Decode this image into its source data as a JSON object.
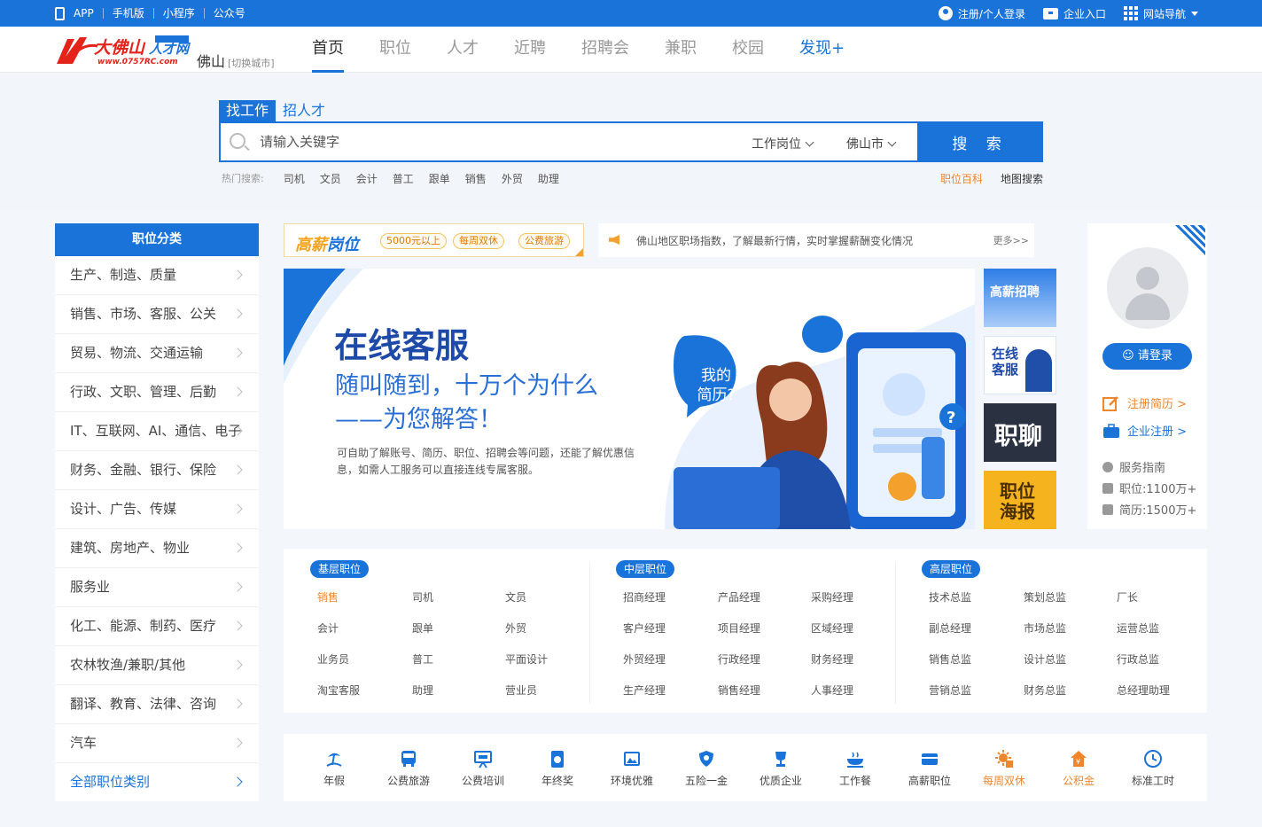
{
  "topbar": {
    "links": [
      "APP",
      "手机版",
      "小程序",
      "公众号"
    ],
    "login": "注册/个人登录",
    "enterprise": "企业入口",
    "nav": "网站导航"
  },
  "header": {
    "logo_text": "大佛山人才网",
    "logo_url_text": "www.0757RC.com",
    "city": "佛山",
    "switch_city": "[切换城市]",
    "nav": [
      "首页",
      "职位",
      "人才",
      "近聘",
      "招聘会",
      "兼职",
      "校园",
      "发现+"
    ]
  },
  "search": {
    "tab_job": "找工作",
    "tab_talent": "招人才",
    "placeholder": "请输入关键字",
    "position_select": "工作岗位",
    "city_select": "佛山市",
    "button": "搜 索",
    "hot_label": "热门搜索:",
    "hot_words": [
      "司机",
      "文员",
      "会计",
      "普工",
      "跟单",
      "销售",
      "外贸",
      "助理"
    ],
    "link_baike": "职位百科",
    "link_map": "地图搜索"
  },
  "category": {
    "title": "职位分类",
    "items": [
      "生产、制造、质量",
      "销售、市场、客服、公关",
      "贸易、物流、交通运输",
      "行政、文职、管理、后勤",
      "IT、互联网、AI、通信、电子",
      "财务、金融、银行、保险",
      "设计、广告、传媒",
      "建筑、房地产、物业",
      "服务业",
      "化工、能源、制药、医疗",
      "农林牧渔/兼职/其他",
      "翻译、教育、法律、咨询",
      "汽车"
    ],
    "all": "全部职位类别"
  },
  "promo": {
    "title_a": "高薪",
    "title_b": "岗位",
    "tags": [
      "5000元以上",
      "每周双休",
      "公费旅游"
    ]
  },
  "notice": {
    "text": "佛山地区职场指数，了解最新行情，实时掌握薪酬变化情况",
    "more": "更多>>"
  },
  "banner": {
    "title": "在线客服",
    "line1": "随叫随到，十万个为什么",
    "line2": "——为您解答！",
    "desc": "可自助了解账号、简历、职位、招聘会等问题，还能了解优惠信息，如需人工服务可以直接连线专属客服。",
    "bubble": "我的简历?"
  },
  "thumbs": [
    "高薪招聘",
    "在线客服",
    "职聊",
    "职位海报"
  ],
  "login": {
    "button": "请登录",
    "register_resume": "注册简历 >",
    "register_company": "企业注册 >",
    "guide": "服务指南",
    "jobs": "职位:1100万+",
    "resumes": "简历:1500万+"
  },
  "levels": [
    {
      "title": "基层职位",
      "items": [
        "销售",
        "司机",
        "文员",
        "会计",
        "跟单",
        "外贸",
        "业务员",
        "普工",
        "平面设计",
        "淘宝客服",
        "助理",
        "营业员"
      ]
    },
    {
      "title": "中层职位",
      "items": [
        "招商经理",
        "产品经理",
        "采购经理",
        "客户经理",
        "项目经理",
        "区域经理",
        "外贸经理",
        "行政经理",
        "财务经理",
        "生产经理",
        "销售经理",
        "人事经理"
      ]
    },
    {
      "title": "高层职位",
      "items": [
        "技术总监",
        "策划总监",
        "厂长",
        "副总经理",
        "市场总监",
        "运营总监",
        "销售总监",
        "设计总监",
        "行政总监",
        "营销总监",
        "财务总监",
        "总经理助理"
      ]
    }
  ],
  "benefits": [
    {
      "label": "年假",
      "icon": "beach-icon",
      "accent": false
    },
    {
      "label": "公费旅游",
      "icon": "bus-icon",
      "accent": false
    },
    {
      "label": "公费培训",
      "icon": "training-icon",
      "accent": false
    },
    {
      "label": "年终奖",
      "icon": "bonus-icon",
      "accent": false
    },
    {
      "label": "环境优雅",
      "icon": "picture-icon",
      "accent": false
    },
    {
      "label": "五险一金",
      "icon": "shield-icon",
      "accent": false
    },
    {
      "label": "优质企业",
      "icon": "trophy-icon",
      "accent": false
    },
    {
      "label": "工作餐",
      "icon": "meal-icon",
      "accent": false
    },
    {
      "label": "高薪职位",
      "icon": "card-icon",
      "accent": false
    },
    {
      "label": "每周双休",
      "icon": "sun-icon",
      "accent": true
    },
    {
      "label": "公积金",
      "icon": "house-icon",
      "accent": true
    },
    {
      "label": "标准工时",
      "icon": "clock-icon",
      "accent": false
    }
  ],
  "colors": {
    "primary": "#1a73d9",
    "accent": "#f0862b"
  }
}
